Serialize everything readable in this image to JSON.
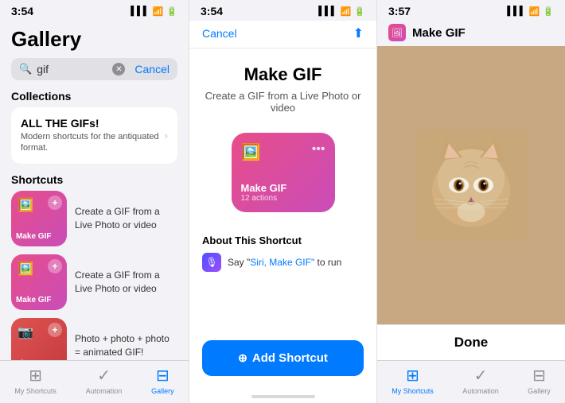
{
  "screen1": {
    "status_time": "3:54",
    "title": "Gallery",
    "search_value": "gif",
    "search_cancel": "Cancel",
    "collections_label": "Collections",
    "collection": {
      "name": "ALL THE GIFs!",
      "desc": "Modern shortcuts for the antiquated format."
    },
    "shortcuts_label": "Shortcuts",
    "shortcuts": [
      {
        "name": "Make GIF",
        "desc": "Create a GIF from a Live Photo or video",
        "color": "pink",
        "icon": "🖼️"
      },
      {
        "name": "Make GIF",
        "desc": "Create a GIF from a Live Photo or video",
        "color": "pink",
        "icon": "🖼️"
      },
      {
        "name": "Shoot A GIF",
        "desc": "Photo + photo + photo = animated GIF!",
        "color": "red",
        "icon": "📷"
      }
    ],
    "tabs": [
      {
        "label": "My Shortcuts",
        "icon": "⊞",
        "active": false
      },
      {
        "label": "Automation",
        "icon": "✓",
        "active": false
      },
      {
        "label": "Gallery",
        "icon": "⊟",
        "active": true
      }
    ]
  },
  "screen2": {
    "status_time": "3:54",
    "cancel_label": "Cancel",
    "title": "Make GIF",
    "subtitle": "Create a GIF from a Live Photo or video",
    "card_name": "Make GIF",
    "card_actions": "12 actions",
    "about_label": "About This Shortcut",
    "siri_text": "Say \"",
    "siri_quote": "Siri, Make GIF\"",
    "siri_end": " to run",
    "add_shortcut_label": "Add Shortcut"
  },
  "screen3": {
    "status_time": "3:57",
    "nav_title": "Make GIF",
    "done_label": "Done",
    "tabs": [
      {
        "label": "My Shortcuts",
        "icon": "⊞",
        "active": true
      },
      {
        "label": "Automation",
        "icon": "✓",
        "active": false
      },
      {
        "label": "Gallery",
        "icon": "⊟",
        "active": false
      }
    ]
  }
}
